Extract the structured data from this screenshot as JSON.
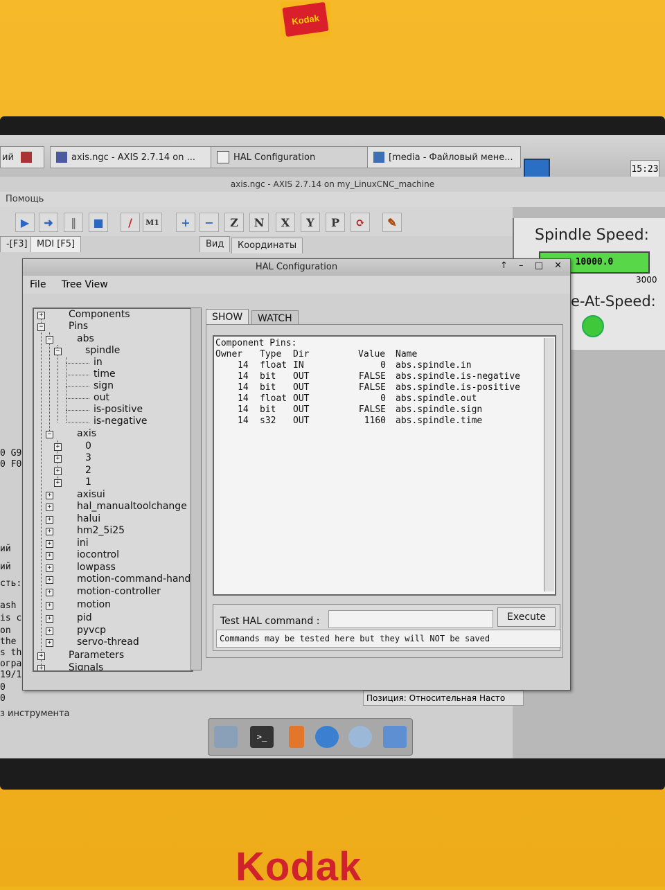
{
  "device": {
    "brand_top": "Kodak",
    "brand_bottom": "Kodak"
  },
  "taskbar": {
    "tasks": [
      {
        "label": "axis.ngc - AXIS 2.7.14 on ..."
      },
      {
        "label": "HAL Configuration"
      },
      {
        "label": "[media - Файловый мене..."
      }
    ],
    "clock": "15:23"
  },
  "axis": {
    "title": "axis.ngc - AXIS 2.7.14 on my_LinuxCNC_machine",
    "menu_help": "Помощь",
    "tabs": [
      "-[F3]",
      "MDI [F5]"
    ],
    "right_tabs": [
      "Вид",
      "Координаты"
    ],
    "spindle_speed_label": "Spindle Speed:",
    "spindle_speed_value": "10000.0",
    "spindle_speed_max": "3000",
    "at_speed_label": "e-At-Speed:",
    "side_text": [
      "0 G9",
      "0 F0",
      "ий",
      "ий",
      "сть:",
      "ash",
      "is c",
      " on",
      "the",
      "s th",
      "огра",
      "19/1",
      "0",
      "0"
    ],
    "position_status": "Позиция: Относительная Насто",
    "bottom_status": "з инструмента",
    "toolbar_letters": [
      "Z",
      "N",
      "X",
      "Y",
      "P"
    ]
  },
  "hal": {
    "title": "HAL Configuration",
    "window_controls": "↑ – □ ✕",
    "menu": [
      "File",
      "Tree View"
    ],
    "tabs": {
      "show": "SHOW",
      "watch": "WATCH"
    },
    "tree": {
      "components": "Components",
      "pins": "Pins",
      "abs": "abs",
      "spindle": "spindle",
      "spindle_children": [
        "in",
        "time",
        "sign",
        "out",
        "is-positive",
        "is-negative"
      ],
      "axis": "axis",
      "axis_children": [
        "0",
        "3",
        "2",
        "1"
      ],
      "others": [
        "axisui",
        "hal_manualtoolchange",
        "halui",
        "hm2_5i25",
        "ini",
        "iocontrol",
        "lowpass",
        "motion-command-handler",
        "motion-controller",
        "motion",
        "pid",
        "pyvcp",
        "servo-thread"
      ],
      "parameters": "Parameters",
      "signals": "Signals"
    },
    "pins_header": "Component Pins:",
    "columns": [
      "Owner",
      "Type",
      "Dir",
      "Value",
      "Name"
    ],
    "rows": [
      {
        "owner": "14",
        "type": "float",
        "dir": "IN",
        "value": "0",
        "name": "abs.spindle.in"
      },
      {
        "owner": "14",
        "type": "bit",
        "dir": "OUT",
        "value": "FALSE",
        "name": "abs.spindle.is-negative"
      },
      {
        "owner": "14",
        "type": "bit",
        "dir": "OUT",
        "value": "FALSE",
        "name": "abs.spindle.is-positive"
      },
      {
        "owner": "14",
        "type": "float",
        "dir": "OUT",
        "value": "0",
        "name": "abs.spindle.out"
      },
      {
        "owner": "14",
        "type": "bit",
        "dir": "OUT",
        "value": "FALSE",
        "name": "abs.spindle.sign"
      },
      {
        "owner": "14",
        "type": "s32",
        "dir": "OUT",
        "value": "1160",
        "name": "abs.spindle.time"
      }
    ],
    "test_label": "Test HAL command :",
    "test_value": "",
    "execute_label": "Execute",
    "note": "Commands may be tested here but they will NOT be saved"
  }
}
